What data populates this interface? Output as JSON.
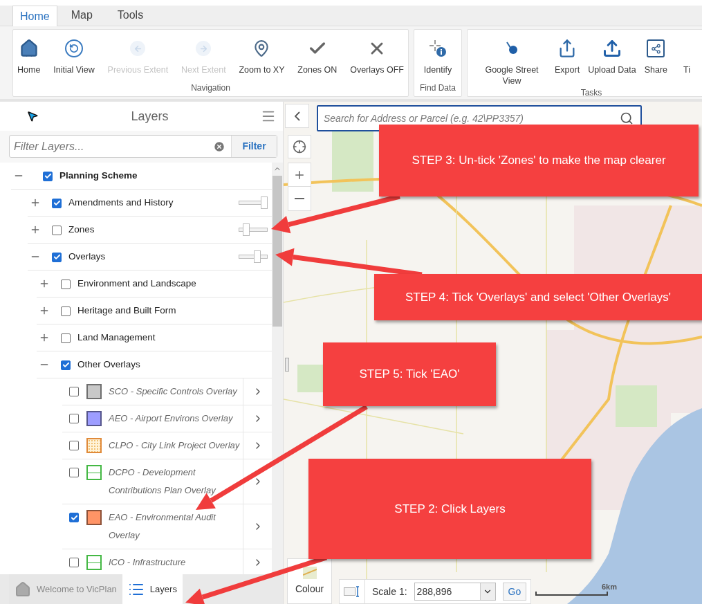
{
  "ribbon": {
    "tabs": [
      {
        "label": "Home",
        "selected": true
      },
      {
        "label": "Map",
        "selected": false
      },
      {
        "label": "Tools",
        "selected": false
      }
    ],
    "groups": [
      {
        "title": "Navigation",
        "buttons": [
          {
            "label": "Home",
            "disabled": false
          },
          {
            "label": "Initial View",
            "disabled": false
          },
          {
            "label": "Previous Extent",
            "disabled": true
          },
          {
            "label": "Next Extent",
            "disabled": true
          },
          {
            "label": "Zoom to XY",
            "disabled": false
          },
          {
            "label": "Zones ON",
            "disabled": false
          },
          {
            "label": "Overlays OFF",
            "disabled": false
          }
        ]
      },
      {
        "title": "Find Data",
        "buttons": [
          {
            "label": "Identify",
            "disabled": false
          }
        ]
      },
      {
        "title": "Tasks",
        "buttons": [
          {
            "label": "Google Street View",
            "disabled": false
          },
          {
            "label": "Export",
            "disabled": false
          },
          {
            "label": "Upload Data",
            "disabled": false
          },
          {
            "label": "Share",
            "disabled": false
          },
          {
            "label": "Ti",
            "disabled": false
          }
        ]
      }
    ]
  },
  "layers_panel": {
    "title": "Layers",
    "filter": {
      "placeholder": "Filter Layers...",
      "button": "Filter"
    },
    "tree": [
      {
        "kind": "group",
        "label": "Planning Scheme",
        "checked": true,
        "expanded": true,
        "children": [
          {
            "kind": "group",
            "label": "Amendments and History",
            "checked": true,
            "expanded": false,
            "level": 1
          },
          {
            "kind": "group",
            "label": "Zones",
            "checked": false,
            "expanded": false,
            "level": 0.2
          },
          {
            "kind": "group",
            "label": "Overlays",
            "checked": true,
            "expanded": true,
            "level": 0.7,
            "children": [
              {
                "kind": "group",
                "label": "Environment and Landscape",
                "checked": false,
                "expanded": false
              },
              {
                "kind": "group",
                "label": "Heritage and Built Form",
                "checked": false,
                "expanded": false
              },
              {
                "kind": "group",
                "label": "Land Management",
                "checked": false,
                "expanded": false
              },
              {
                "kind": "group",
                "label": "Other Overlays",
                "checked": true,
                "expanded": true,
                "children": [
                  {
                    "kind": "legend",
                    "label": "SCO - Specific Controls Overlay",
                    "checked": false,
                    "swatch": {
                      "kind": "solid",
                      "color": "#c8c8c8"
                    }
                  },
                  {
                    "kind": "legend",
                    "label": "AEO - Airport Environs Overlay",
                    "checked": false,
                    "swatch": {
                      "kind": "solid",
                      "color": "#9d9dff"
                    }
                  },
                  {
                    "kind": "legend",
                    "label": "CLPO - City Link Project Overlay",
                    "checked": false,
                    "swatch": {
                      "kind": "dotted",
                      "color": "#fff3d9"
                    }
                  },
                  {
                    "kind": "legend",
                    "label": "DCPO - Development Contributions Plan Overlay",
                    "checked": false,
                    "swatch": {
                      "kind": "lined",
                      "color": "#44b844"
                    }
                  },
                  {
                    "kind": "legend",
                    "label": "EAO - Environmental Audit Overlay",
                    "checked": true,
                    "swatch": {
                      "kind": "solid",
                      "color": "#ff9466"
                    }
                  },
                  {
                    "kind": "legend",
                    "label": "ICO - Infrastructure",
                    "checked": false,
                    "swatch": {
                      "kind": "lined",
                      "color": "#44b844"
                    }
                  }
                ]
              }
            ]
          }
        ]
      }
    ],
    "bottom_tabs": [
      {
        "label": "Welcome to VicPlan",
        "selected": false
      },
      {
        "label": "Layers",
        "selected": true
      }
    ]
  },
  "map": {
    "search": {
      "placeholder": "Search for Address or Parcel (e.g. 42\\PP3357)"
    },
    "colour_button": "Colour",
    "scale": {
      "label": "Scale 1:",
      "value": "288,896",
      "go": "Go",
      "bar_label": "6km"
    }
  },
  "callouts": [
    {
      "text": "STEP 3: Un-tick 'Zones' to make the map clearer"
    },
    {
      "text": "STEP 4: Tick 'Overlays' and select 'Other Overlays'"
    },
    {
      "text": "STEP 5: Tick 'EAO'"
    },
    {
      "text": "STEP 2: Click Layers"
    }
  ]
}
